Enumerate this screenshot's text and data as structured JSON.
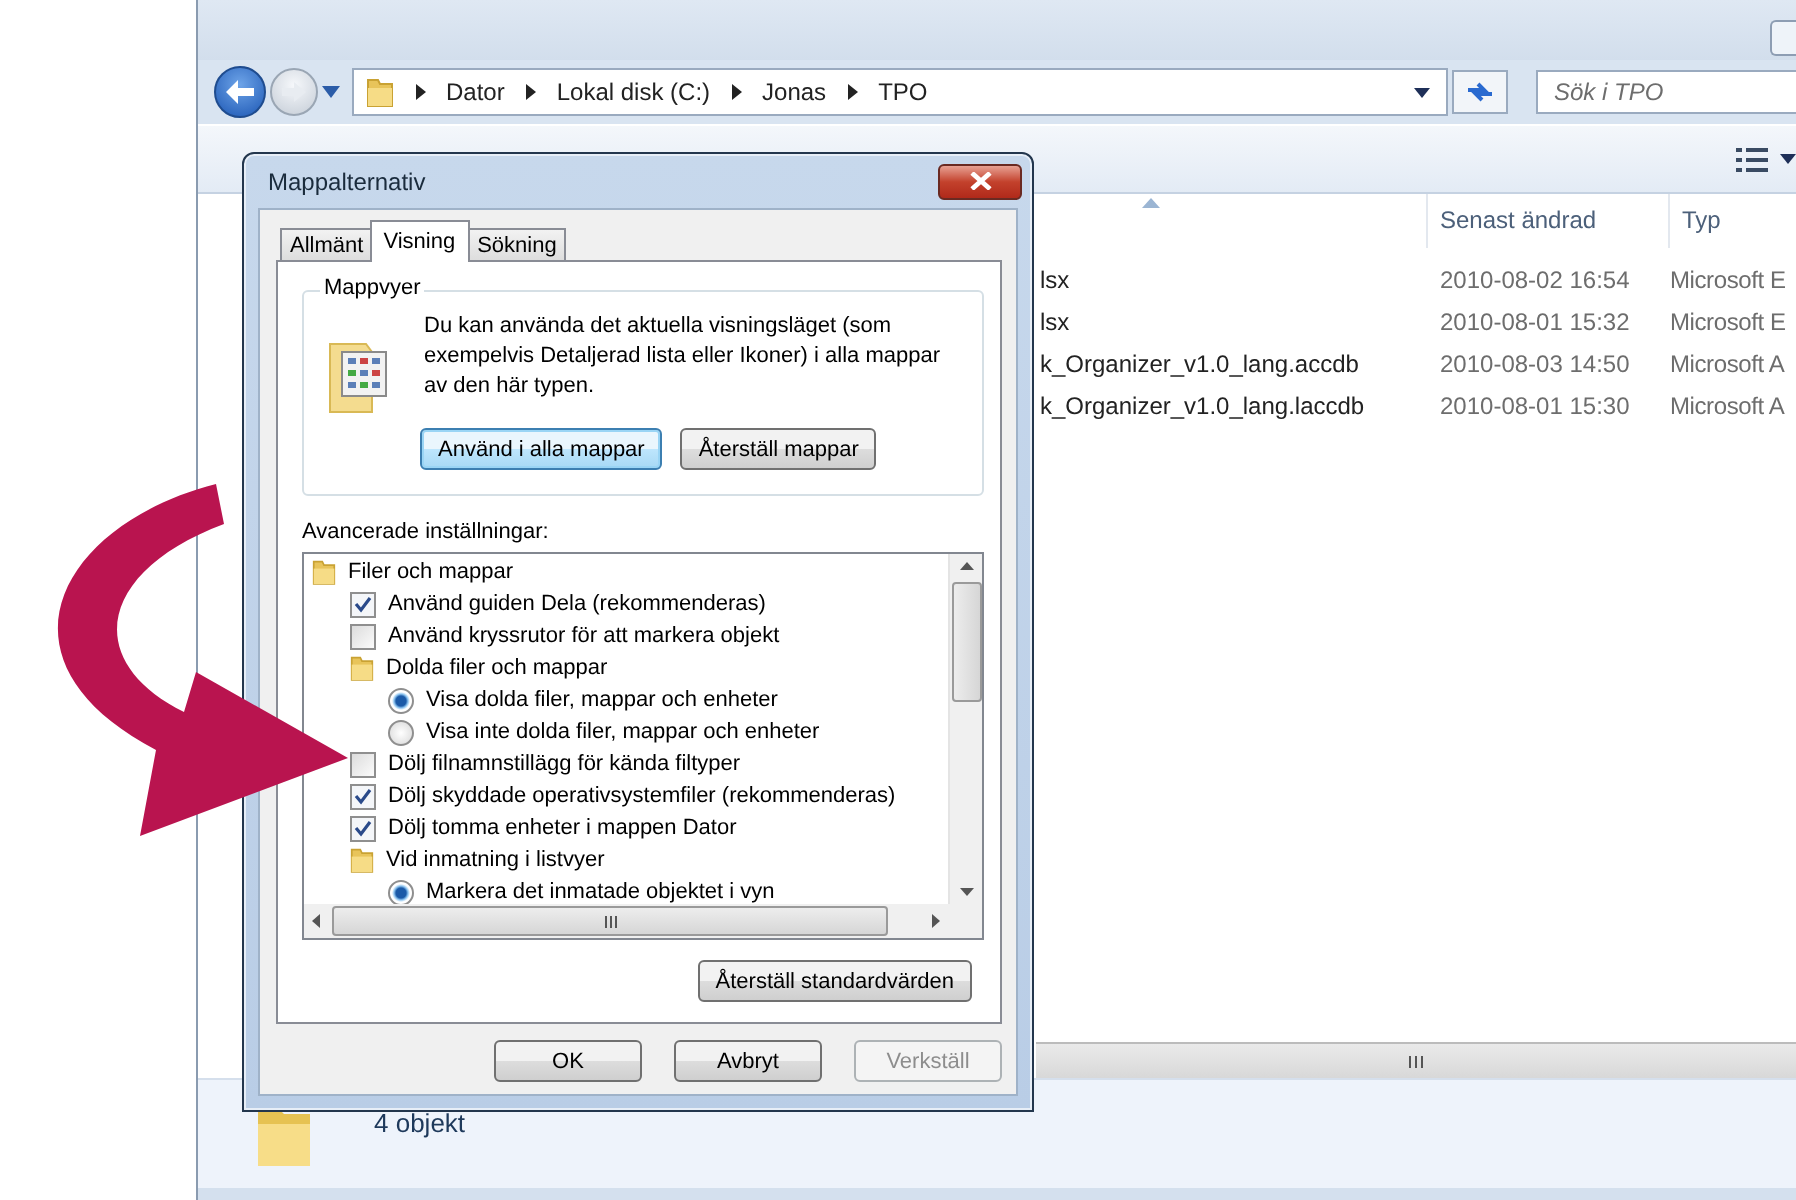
{
  "explorer": {
    "address": {
      "crumbs": [
        "Dator",
        "Lokal disk (C:)",
        "Jonas",
        "TPO"
      ]
    },
    "search": {
      "placeholder": "Sök i TPO"
    },
    "columns": [
      "Senast ändrad",
      "Typ"
    ],
    "files": [
      {
        "name": "lsx",
        "modified": "2010-08-02 16:54",
        "type": "Microsoft E"
      },
      {
        "name": "lsx",
        "modified": "2010-08-01 15:32",
        "type": "Microsoft E"
      },
      {
        "name": "k_Organizer_v1.0_lang.accdb",
        "modified": "2010-08-03 14:50",
        "type": "Microsoft A"
      },
      {
        "name": "k_Organizer_v1.0_lang.laccdb",
        "modified": "2010-08-01 15:30",
        "type": "Microsoft A"
      }
    ],
    "status_bar": {
      "count": "4 objekt"
    }
  },
  "dialog": {
    "title": "Mappalternativ",
    "tabs": [
      {
        "label": "Allmänt",
        "selected": false
      },
      {
        "label": "Visning",
        "selected": true
      },
      {
        "label": "Sökning",
        "selected": false
      }
    ],
    "group": {
      "title": "Mappvyer",
      "description": "Du kan använda det aktuella visningsläget (som exempelvis Detaljerad lista eller Ikoner) i alla mappar av den här typen.",
      "buttons": [
        {
          "label": "Använd i alla mappar",
          "focused": true
        },
        {
          "label": "Återställ mappar",
          "focused": false
        }
      ]
    },
    "advanced": {
      "label": "Avancerade inställningar:",
      "items": [
        {
          "kind": "folder",
          "label": "Filer och mappar",
          "children": [
            {
              "kind": "checkbox",
              "label": "Använd guiden Dela (rekommenderas)",
              "checked": true
            },
            {
              "kind": "checkbox",
              "label": "Använd kryssrutor för att markera objekt",
              "checked": false
            },
            {
              "kind": "folder",
              "label": "Dolda filer och mappar",
              "children": [
                {
                  "kind": "radio",
                  "label": "Visa dolda filer, mappar och enheter",
                  "selected": true
                },
                {
                  "kind": "radio",
                  "label": "Visa inte dolda filer, mappar och enheter",
                  "selected": false
                }
              ]
            },
            {
              "kind": "checkbox",
              "label": "Dölj filnamnstillägg för kända filtyper",
              "checked": false
            },
            {
              "kind": "checkbox",
              "label": "Dölj skyddade operativsystemfiler (rekommenderas)",
              "checked": true
            },
            {
              "kind": "checkbox",
              "label": "Dölj tomma enheter i mappen Dator",
              "checked": true
            },
            {
              "kind": "folder",
              "label": "Vid inmatning i listvyer",
              "children": [
                {
                  "kind": "radio",
                  "label": "Markera det inmatade objektet i vyn",
                  "selected": true
                }
              ]
            }
          ]
        }
      ]
    },
    "reset_button": "Återställ standardvärden",
    "buttons": [
      {
        "label": "OK",
        "disabled": false
      },
      {
        "label": "Avbryt",
        "disabled": false
      },
      {
        "label": "Verkställ",
        "disabled": true
      }
    ]
  }
}
